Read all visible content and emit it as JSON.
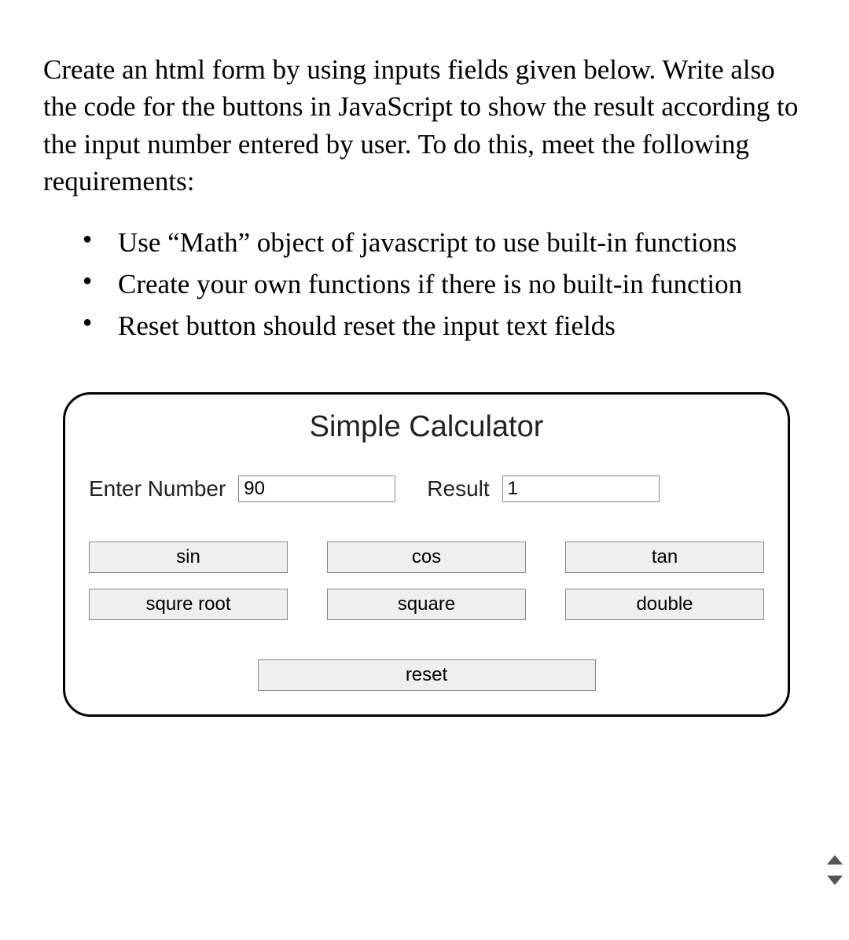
{
  "intro": "Create an html form by using inputs fields given below. Write also the code for the buttons in JavaScript to show the result according to the input number entered by user. To do this, meet the following requirements:",
  "requirements": [
    "Use “Math” object of javascript to use built-in functions",
    "Create your own functions if there is no built-in function",
    "Reset button should reset the input text fields"
  ],
  "calculator": {
    "title": "Simple Calculator",
    "enter_label": "Enter Number",
    "enter_value": "90",
    "result_label": "Result",
    "result_value": "1",
    "buttons": {
      "sin": "sin",
      "cos": "cos",
      "tan": "tan",
      "sqrt": "squre root",
      "square": "square",
      "double": "double",
      "reset": "reset"
    }
  }
}
